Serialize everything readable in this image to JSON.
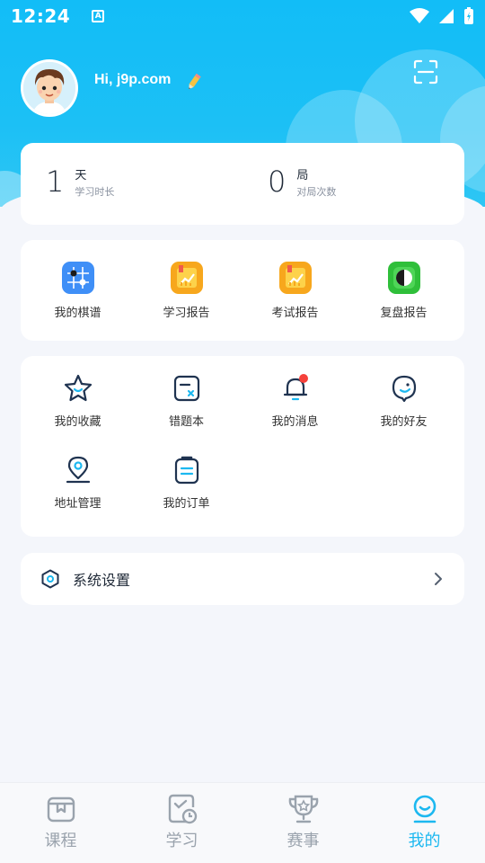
{
  "status": {
    "time": "12:24",
    "a_badge": "A"
  },
  "profile": {
    "greeting": "Hi, j9p.com"
  },
  "stats": [
    {
      "value": "1",
      "unit": "天",
      "label": "学习时长"
    },
    {
      "value": "0",
      "unit": "局",
      "label": "对局次数"
    }
  ],
  "reports": [
    {
      "label": "我的棋谱",
      "icon": "board-record-icon"
    },
    {
      "label": "学习报告",
      "icon": "study-report-icon"
    },
    {
      "label": "考试报告",
      "icon": "exam-report-icon"
    },
    {
      "label": "复盘报告",
      "icon": "review-report-icon"
    }
  ],
  "tools": [
    {
      "label": "我的收藏",
      "icon": "star-icon"
    },
    {
      "label": "错题本",
      "icon": "mistake-book-icon"
    },
    {
      "label": "我的消息",
      "icon": "bell-icon"
    },
    {
      "label": "我的好友",
      "icon": "friend-icon"
    },
    {
      "label": "地址管理",
      "icon": "location-icon"
    },
    {
      "label": "我的订单",
      "icon": "order-icon"
    }
  ],
  "settings": {
    "label": "系统设置"
  },
  "nav": [
    {
      "label": "课程",
      "icon": "course-icon",
      "active": false
    },
    {
      "label": "学习",
      "icon": "study-icon",
      "active": false
    },
    {
      "label": "赛事",
      "icon": "trophy-icon",
      "active": false
    },
    {
      "label": "我的",
      "icon": "profile-icon",
      "active": true
    }
  ],
  "colors": {
    "primary": "#1cb8f0",
    "header": "#12bdf7",
    "notification_dot": "#f5413b"
  }
}
